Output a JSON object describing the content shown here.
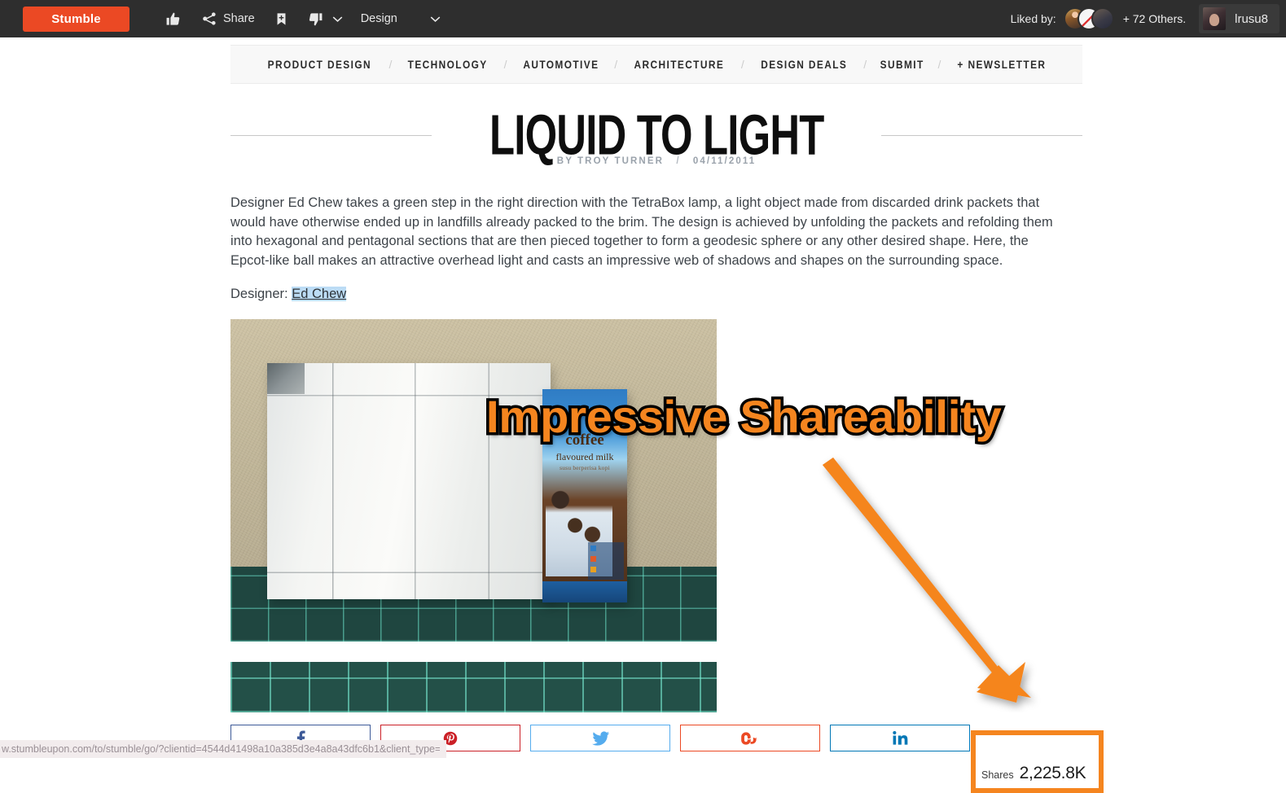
{
  "toolbar": {
    "stumble_label": "Stumble",
    "thumb_up_icon": "thumbs-up-icon",
    "share_icon": "share-nodes-icon",
    "share_label": "Share",
    "bookmark_icon": "bookmark-add-icon",
    "thumb_down_icon": "thumbs-down-icon",
    "caret_icon": "chevron-down-icon",
    "channel_label": "Design",
    "liked_by_label": "Liked by:",
    "others_label": "+ 72 Others.",
    "user_name": "lrusu8",
    "accent_color": "#eb4924",
    "background_color": "#2e2e2e"
  },
  "site_nav": {
    "items": [
      {
        "label": "PRODUCT DESIGN"
      },
      {
        "label": "TECHNOLOGY"
      },
      {
        "label": "AUTOMOTIVE"
      },
      {
        "label": "ARCHITECTURE"
      },
      {
        "label": "DESIGN DEALS"
      },
      {
        "label": "SUBMIT"
      },
      {
        "label": "+ NEWSLETTER"
      }
    ],
    "separator": "/"
  },
  "article": {
    "title": "LIQUID TO LIGHT",
    "byline_author": "BY TROY TURNER",
    "byline_separator": "/",
    "byline_date": "04/11/2011",
    "body": "Designer Ed Chew takes a green step in the right direction with the TetraBox lamp, a light object made from discarded drink packets that would have otherwise ended up in landfills already packed to the brim. The design is achieved by unfolding the packets and refolding them into hexagonal and pentagonal sections that are then pieced together to form a geodesic sphere or any other desired shape. Here, the Epcot-like ball makes an attractive overhead light and casts an impressive web of shadows and shapes on the surrounding space.",
    "designer_label": "Designer:",
    "designer_name": "Ed Chew"
  },
  "photo_main": {
    "carton_brand_line1": "coffee",
    "carton_brand_line2": "flavoured milk",
    "carton_brand_line3": "susu berperisa kopi"
  },
  "share_bar": {
    "buttons": [
      {
        "name": "facebook",
        "glyph": "f",
        "color": "#3d5a98"
      },
      {
        "name": "pinterest",
        "glyph": "Ⓟ",
        "color": "#cb2027"
      },
      {
        "name": "twitter",
        "glyph": "🐦",
        "color": "#55acee"
      },
      {
        "name": "stumbleupon",
        "glyph": "su",
        "color": "#eb4924"
      },
      {
        "name": "linkedin",
        "glyph": "in",
        "color": "#0077b5"
      }
    ]
  },
  "shares": {
    "label": "Shares",
    "value": "2,225.8K",
    "highlight_color": "#f5851f"
  },
  "annotation": {
    "text": "Impressive Shareability",
    "color": "#f5851f",
    "outline_color": "#000000",
    "arrow_icon": "arrow-down-right-icon"
  },
  "status_bar": {
    "url": "w.stumbleupon.com/to/stumble/go/?clientid=4544d41498a10a385d3e4a8a43dfc6b1&client_type=…"
  }
}
